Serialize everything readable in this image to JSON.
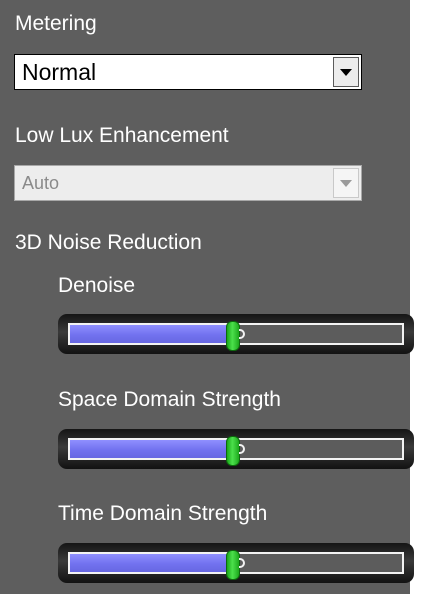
{
  "metering": {
    "label": "Metering",
    "value": "Normal",
    "dropdown_icon": "chevron-down-icon"
  },
  "low_lux": {
    "label": "Low Lux Enhancement",
    "value": "Auto",
    "enabled": false,
    "dropdown_icon": "chevron-down-icon"
  },
  "noise_reduction": {
    "heading": "3D Noise Reduction",
    "sliders": [
      {
        "label": "Denoise",
        "level": 0.49
      },
      {
        "label": "Space Domain Strength",
        "level": 0.49
      },
      {
        "label": "Time Domain Strength",
        "level": 0.49
      }
    ]
  },
  "colors": {
    "panel_background": "#5e5e5e",
    "slider_fill": "#7474ef",
    "slider_thumb": "#2ec42e"
  }
}
